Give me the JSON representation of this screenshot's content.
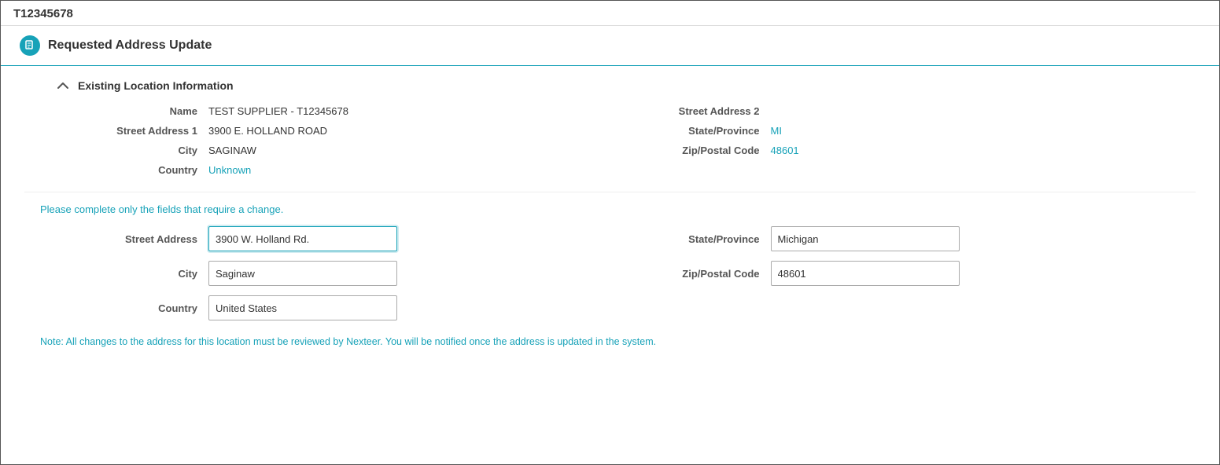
{
  "topbar": {
    "title": "T12345678"
  },
  "section": {
    "icon_label": "document-icon",
    "title": "Requested Address Update"
  },
  "subsection": {
    "title": "Existing Location Information",
    "chevron": "^"
  },
  "existing": {
    "name_label": "Name",
    "name_value": "TEST SUPPLIER - T12345678",
    "street1_label": "Street Address 1",
    "street1_value": "3900 E. HOLLAND ROAD",
    "street2_label": "Street Address 2",
    "street2_value": "",
    "city_label": "City",
    "city_value": "SAGINAW",
    "state_label": "State/Province",
    "state_value": "MI",
    "country_label": "Country",
    "country_value": "Unknown",
    "zip_label": "Zip/Postal Code",
    "zip_value": "48601"
  },
  "instruction": "Please complete only the fields that require a change.",
  "form": {
    "street_label": "Street Address",
    "street_value": "3900 W. Holland Rd.",
    "city_label": "City",
    "city_value": "Saginaw",
    "country_label": "Country",
    "country_value": "United States",
    "state_label": "State/Province",
    "state_value": "Michigan",
    "zip_label": "Zip/Postal Code",
    "zip_value": "48601"
  },
  "note": "Note: All changes to the address for this location must be reviewed by Nexteer. You will be notified once the address is updated in the system."
}
